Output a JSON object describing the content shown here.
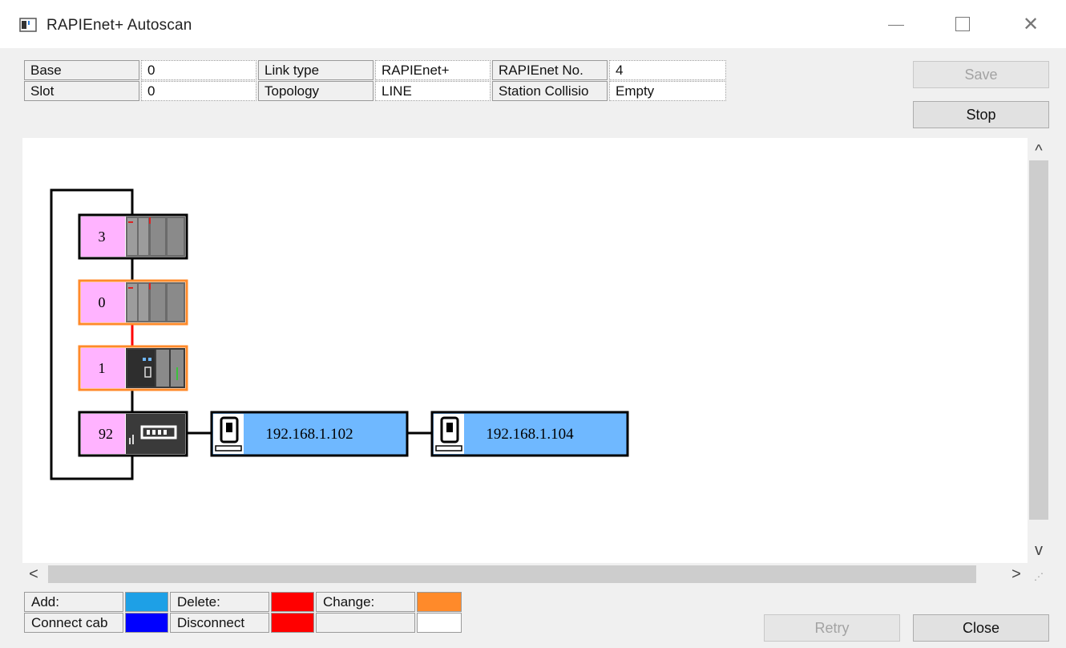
{
  "window": {
    "title": "RAPIEnet+ Autoscan",
    "controls": {
      "minimize": "",
      "maximize": "",
      "close": "✕"
    }
  },
  "info": {
    "base_label": "Base",
    "base_value": "0",
    "linktype_label": "Link type",
    "linktype_value": "RAPIEnet+",
    "rapinetno_label": "RAPIEnet No.",
    "rapinetno_value": "4",
    "slot_label": "Slot",
    "slot_value": "0",
    "topology_label": "Topology",
    "topology_value": "LINE",
    "collision_label": "Station Collisio",
    "collision_value": "Empty"
  },
  "buttons": {
    "save": "Save",
    "stop": "Stop",
    "retry": "Retry",
    "close": "Close"
  },
  "network": {
    "stations": [
      {
        "number": "3",
        "status": "normal"
      },
      {
        "number": "0",
        "status": "change"
      },
      {
        "number": "1",
        "status": "change"
      },
      {
        "number": "92",
        "status": "normal"
      }
    ],
    "devices": [
      {
        "ip": "192.168.1.102"
      },
      {
        "ip": "192.168.1.104"
      }
    ]
  },
  "scroll": {
    "up": "^",
    "down": "v",
    "left": "<",
    "right": ">"
  },
  "legend": {
    "add_label": "Add:",
    "add_color": "#1ea0e6",
    "delete_label": "Delete:",
    "delete_color": "#ff0000",
    "change_label": "Change:",
    "change_color": "#ff8a2a",
    "connect_label": "Connect cab",
    "connect_color": "#0000ff",
    "disconnect_label": "Disconnect",
    "disconnect_color": "#ff0000",
    "blank_label": "",
    "blank_color": "#ffffff"
  },
  "colors": {
    "station_number_bg": "#ffb3ff",
    "device_bg": "#6fb8ff",
    "change_border": "#ff8a2a",
    "link_red": "#ff0000"
  }
}
